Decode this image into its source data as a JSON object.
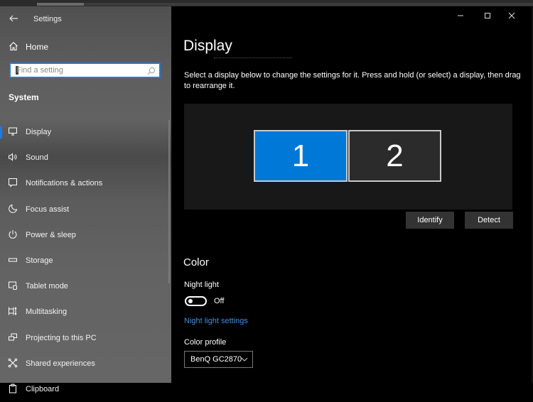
{
  "window": {
    "title": "Settings",
    "controls": {
      "minimize": "minimize",
      "maximize": "maximize",
      "close": "close"
    }
  },
  "sidebar": {
    "back_icon": "back-arrow-icon",
    "home": {
      "label": "Home",
      "icon": "home-icon"
    },
    "search": {
      "placeholder": "Find a setting",
      "value": "",
      "icon": "search-icon"
    },
    "section": "System",
    "items": [
      {
        "label": "Display",
        "icon": "monitor-icon",
        "active": true
      },
      {
        "label": "Sound",
        "icon": "speaker-icon"
      },
      {
        "label": "Notifications & actions",
        "icon": "notification-icon"
      },
      {
        "label": "Focus assist",
        "icon": "moon-icon"
      },
      {
        "label": "Power & sleep",
        "icon": "power-icon"
      },
      {
        "label": "Storage",
        "icon": "storage-icon"
      },
      {
        "label": "Tablet mode",
        "icon": "tablet-mode-icon"
      },
      {
        "label": "Multitasking",
        "icon": "multitasking-icon"
      },
      {
        "label": "Projecting to this PC",
        "icon": "projecting-icon"
      },
      {
        "label": "Shared experiences",
        "icon": "shared-experiences-icon"
      },
      {
        "label": "Clipboard",
        "icon": "clipboard-icon"
      }
    ]
  },
  "main": {
    "title": "Display",
    "description": "Select a display below to change the settings for it. Press and hold (or select) a display, then drag to rearrange it.",
    "monitors": [
      {
        "label": "1",
        "selected": true
      },
      {
        "label": "2",
        "selected": false
      }
    ],
    "identify_label": "Identify",
    "detect_label": "Detect",
    "color": {
      "heading": "Color",
      "night_light_label": "Night light",
      "night_light_state": "Off",
      "night_light_on": false,
      "night_light_settings_link": "Night light settings",
      "color_profile_label": "Color profile",
      "color_profile_value": "BenQ GC2870"
    }
  },
  "colors": {
    "accent": "#0078d7",
    "link": "#3d8fe0",
    "search_border": "#1e7be0"
  }
}
